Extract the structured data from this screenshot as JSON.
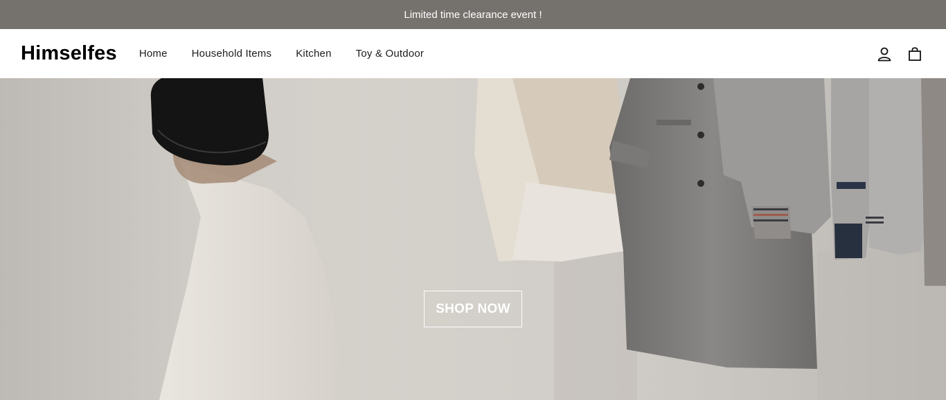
{
  "announcement": {
    "text": "Limited time clearance event !"
  },
  "header": {
    "logo": "Himselfes",
    "nav": [
      {
        "label": "Home"
      },
      {
        "label": "Household Items"
      },
      {
        "label": "Kitchen"
      },
      {
        "label": "Toy & Outdoor"
      }
    ],
    "icons": [
      "account-icon",
      "cart-icon"
    ]
  },
  "hero": {
    "cta_label": "SHOP NOW"
  },
  "colors": {
    "announcement_bg": "#75726d",
    "header_bg": "#ffffff",
    "cta_border": "#ffffff"
  }
}
